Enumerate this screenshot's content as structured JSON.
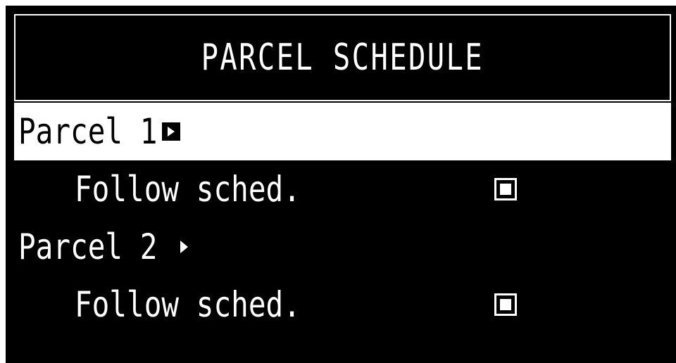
{
  "screen": {
    "title": "PARCEL SCHEDULE"
  },
  "menu": {
    "items": [
      {
        "label": "Parcel 1",
        "selected": true,
        "icon": "triangle-right-icon",
        "sub": {
          "label": "Follow sched.",
          "checked": true
        }
      },
      {
        "label": "Parcel 2",
        "selected": false,
        "icon": "triangle-right-icon",
        "sub": {
          "label": "Follow sched.",
          "checked": true
        }
      }
    ]
  },
  "colors": {
    "background": "#000000",
    "foreground": "#ffffff",
    "selection": "#ffffff"
  }
}
